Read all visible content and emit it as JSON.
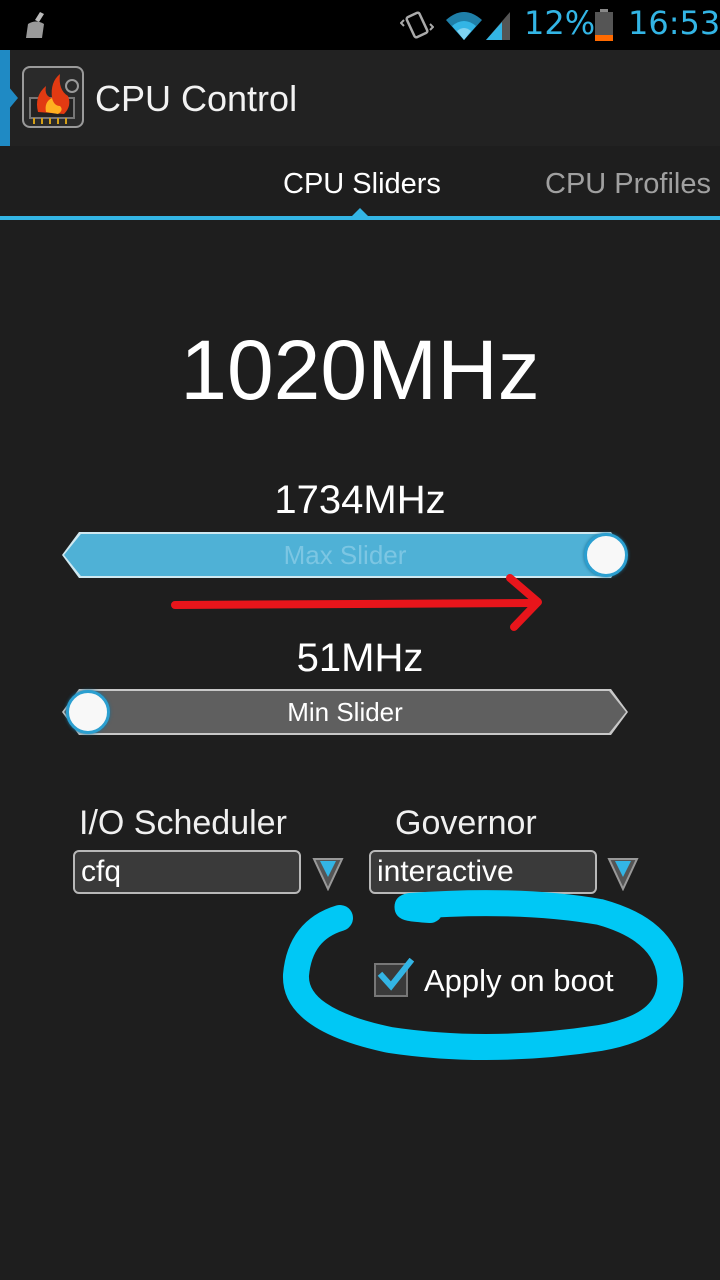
{
  "status_bar": {
    "battery_percent": "12%",
    "time": "16:53",
    "icons": [
      "broom-icon",
      "vibrate-icon",
      "wifi-icon",
      "signal-icon",
      "battery-icon"
    ]
  },
  "action_bar": {
    "title": "CPU Control",
    "icon": "cpu-flame-icon"
  },
  "tabs": [
    {
      "label": "CPU Sliders",
      "selected": true
    },
    {
      "label": "CPU Profiles",
      "selected": false
    }
  ],
  "main": {
    "current_frequency": "1020MHz",
    "max_slider": {
      "value": "1734MHz",
      "label": "Max Slider",
      "level": 1.0
    },
    "min_slider": {
      "value": "51MHz",
      "label": "Min Slider",
      "level": 0.0
    },
    "io_scheduler": {
      "label": "I/O Scheduler",
      "selected": "cfq"
    },
    "governor": {
      "label": "Governor",
      "selected": "interactive"
    },
    "apply_on_boot": {
      "label": "Apply on boot",
      "checked": true
    }
  },
  "colors": {
    "accent": "#33b5e5",
    "annotation_arrow": "#e8151b",
    "annotation_circle": "#00c8f5"
  }
}
